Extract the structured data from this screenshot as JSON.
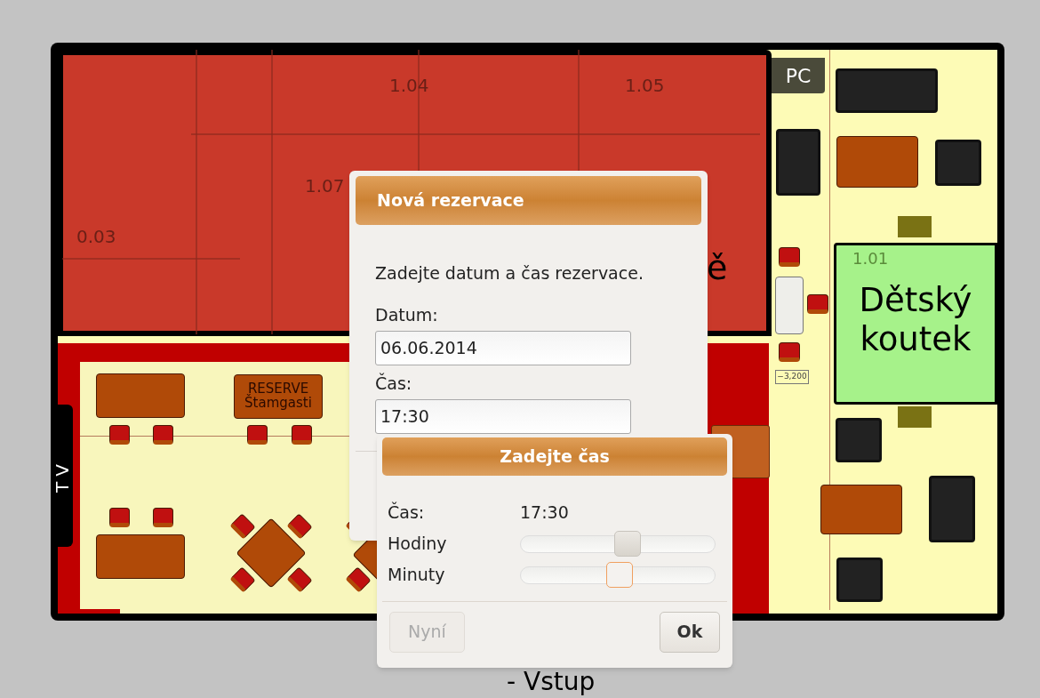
{
  "floor_plan": {
    "room_labels": [
      {
        "text": "1.04",
        "kind": "number"
      },
      {
        "text": "1.05",
        "kind": "number"
      },
      {
        "text": "1.07",
        "kind": "number"
      },
      {
        "text": "0.03",
        "kind": "number"
      },
      {
        "text": "ě",
        "kind": "name"
      }
    ],
    "reserved_table": {
      "lines": [
        "RESERVE",
        "Štamgasti"
      ]
    },
    "tv_label": "TV",
    "pc_label": "PC",
    "kids_corner": {
      "room_number": "1.01",
      "lines": [
        "Dětský",
        "koutek"
      ]
    },
    "level_mark": "−3,200",
    "entrance_label": "- Vstup"
  },
  "reservation_dialog": {
    "title": "Nová rezervace",
    "prompt": "Zadejte datum a čas rezervace.",
    "fields": [
      {
        "label": "Datum:",
        "value": "06.06.2014"
      },
      {
        "label": "Čas:",
        "value": "17:30"
      }
    ]
  },
  "time_picker": {
    "title": "Zadejte čas",
    "time_label": "Čas:",
    "time_value": "17:30",
    "sliders": [
      {
        "label": "Hodiny",
        "level": 0.56,
        "focused": false
      },
      {
        "label": "Minuty",
        "level": 0.51,
        "focused": true
      }
    ],
    "buttons": [
      {
        "label": "Nyní",
        "disabled": true
      },
      {
        "label": "Ok",
        "disabled": false
      }
    ]
  }
}
